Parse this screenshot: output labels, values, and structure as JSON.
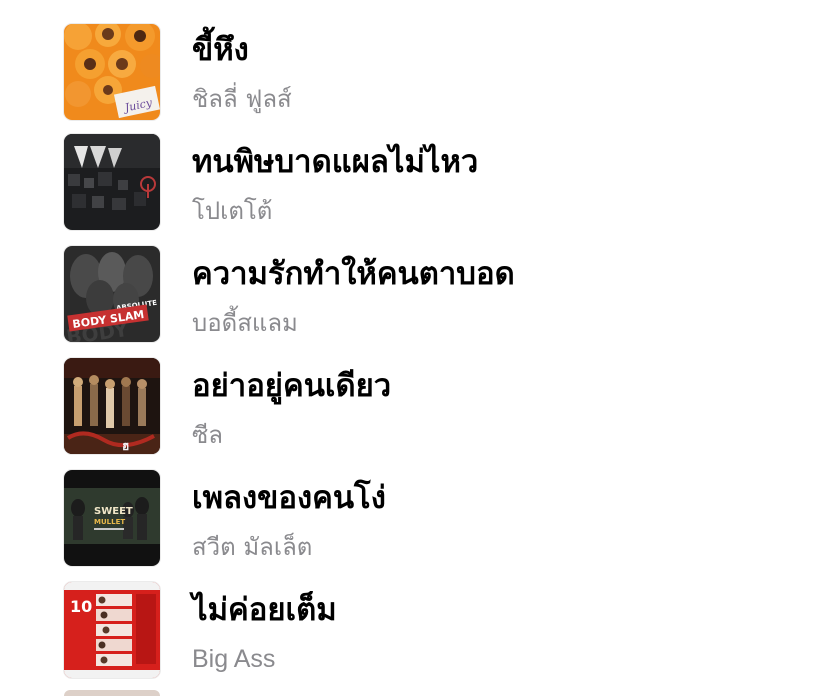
{
  "songs": [
    {
      "title": "ขี้หึง",
      "artist": "ชิลลี่ ฟูลส์",
      "art": "orange-album-art"
    },
    {
      "title": "ทนพิษบาดแผลไม่ไหว",
      "artist": "โปเตโต้",
      "art": "dark-grid-album-art"
    },
    {
      "title": "ความรักทำให้คนตาบอด",
      "artist": "บอดี้สแลม",
      "art": "bodyslam-album-art"
    },
    {
      "title": "อย่าอยู่คนเดียว",
      "artist": "ซีล",
      "art": "band-red-album-art"
    },
    {
      "title": "เพลงของคนโง่",
      "artist": "สวีต มัลเล็ต",
      "art": "sweet-mullet-album-art"
    },
    {
      "title": "ไม่ค่อยเต็ม",
      "artist": "Big Ass",
      "art": "red-photo-album-art"
    }
  ],
  "album_labels": {
    "juicy": "Juicy",
    "absolute": "ABSOLUTE",
    "body_slam": "BODY SLAM",
    "sweet": "SWEET",
    "mullet": "MULLET",
    "ten": "10"
  },
  "colors": {
    "title": "#000000",
    "artist": "#8a8a8e",
    "background": "#ffffff"
  }
}
